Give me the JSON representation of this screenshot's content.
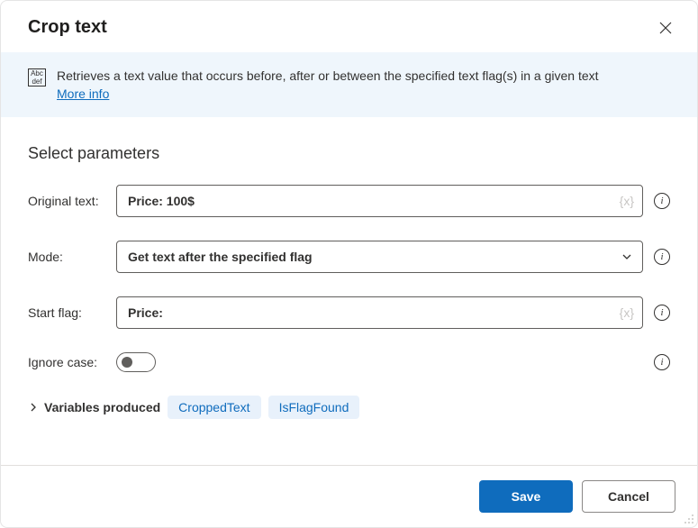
{
  "dialog": {
    "title": "Crop text",
    "description": "Retrieves a text value that occurs before, after or between the specified text flag(s) in a given text",
    "more_info": "More info"
  },
  "section_title": "Select parameters",
  "fields": {
    "original_text": {
      "label": "Original text:",
      "value": "Price: 100$"
    },
    "mode": {
      "label": "Mode:",
      "value": "Get text after the specified flag"
    },
    "start_flag": {
      "label": "Start flag:",
      "value": "Price:"
    },
    "ignore_case": {
      "label": "Ignore case:",
      "value": false
    }
  },
  "variables_section": {
    "label": "Variables produced",
    "chips": [
      "CroppedText",
      "IsFlagFound"
    ]
  },
  "footer": {
    "save": "Save",
    "cancel": "Cancel"
  },
  "icon_text": {
    "abc": "Abc",
    "def": "def"
  }
}
